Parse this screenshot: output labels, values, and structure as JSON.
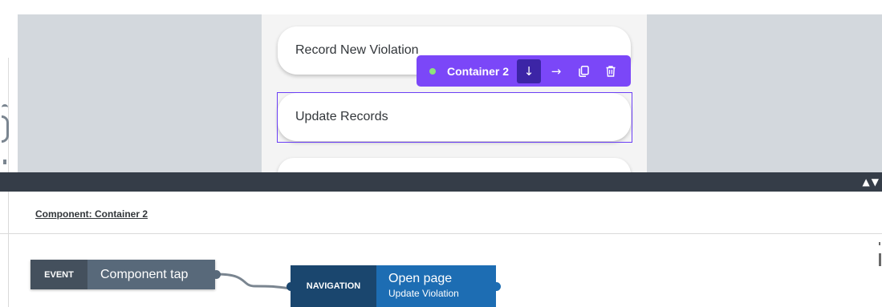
{
  "canvas": {
    "cards": [
      {
        "label": "Record New Violation"
      },
      {
        "label": "Update Records"
      },
      {
        "label": ""
      }
    ],
    "toolbar": {
      "component_name": "Container 2",
      "buttons": [
        {
          "icon": "arrow-down-icon",
          "glyph": "↓"
        },
        {
          "icon": "arrow-right-icon",
          "glyph": "→"
        },
        {
          "icon": "copy-icon"
        },
        {
          "icon": "trash-icon"
        }
      ]
    }
  },
  "panel": {
    "toggle_glyph": "▲▼",
    "component_label": "Component: Container 2"
  },
  "flow": {
    "event_node": {
      "type": "EVENT",
      "title": "Component tap"
    },
    "navigation_node": {
      "type": "NAVIGATION",
      "title": "Open page",
      "subtitle": "Update Violation"
    }
  },
  "colors": {
    "accent_purple": "#7b47f8",
    "event_dark": "#44505d",
    "navigation_blue": "#1d6db3",
    "panel_bar": "#353d48"
  }
}
